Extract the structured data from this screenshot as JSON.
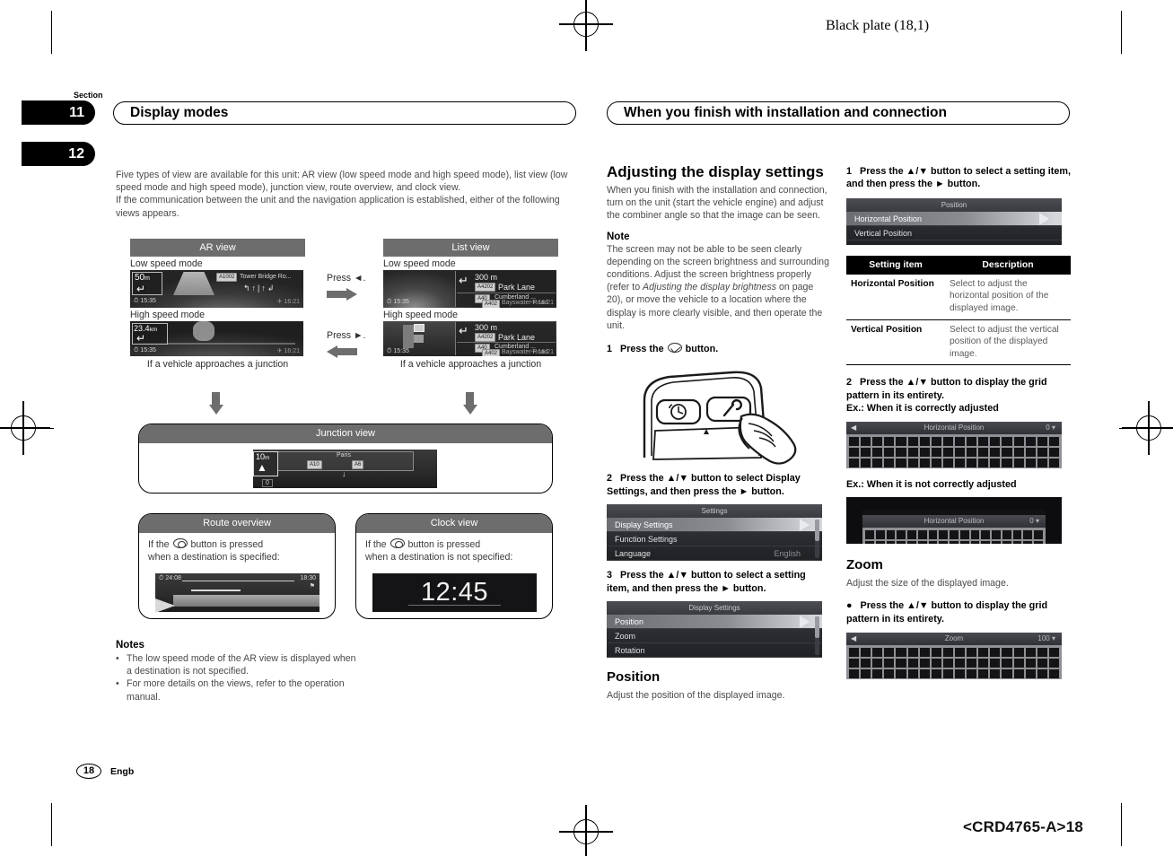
{
  "page": {
    "black_plate": "Black plate (18,1)",
    "crd_code": "<CRD4765-A>18",
    "page_number": "18",
    "language_code": "Engb",
    "section_label": "Section",
    "section_numbers": [
      "11",
      "12"
    ]
  },
  "left": {
    "chapter_title": "Display modes",
    "intro": "Five types of view are available for this unit: AR view (low speed mode and high speed mode), list view (low speed mode and high speed mode), junction view, route overview, and clock view.",
    "intro2": "If the communication between the unit and the navigation application is established, either of the following views appears.",
    "ar_view": {
      "title": "AR view",
      "low_label": "Low speed mode",
      "high_label": "High speed mode",
      "caption": "If a vehicle approaches a junction",
      "low_screen": {
        "distance": "50",
        "distance_unit": "m",
        "road_badge": "A1002",
        "road_name": "Tower Bridge Ro...",
        "time_left": "15:35",
        "time_right": "16:21"
      },
      "high_screen": {
        "distance": "23.4",
        "distance_unit": "km",
        "time_left": "15:35",
        "time_right": "16:21"
      }
    },
    "list_view": {
      "title": "List view",
      "low_label": "Low speed mode",
      "high_label": "High speed mode",
      "caption": "If a vehicle approaches a junction",
      "screen": {
        "distance": "300 m",
        "badge1": "A4202",
        "road1": "Park Lane",
        "badge2": "A40",
        "road2": "Cumberland ...",
        "badge3": "A402",
        "road3": "Bayswater Road",
        "time_left": "15:35",
        "time_right": "16:21"
      }
    },
    "press_left": "Press ◄.",
    "press_right": "Press ►.",
    "junction_view": {
      "title": "Junction view",
      "screen": {
        "distance": "10",
        "distance_unit": "m",
        "city": "Paris",
        "badge1": "A10",
        "badge2": "A6",
        "lane_value": "0"
      }
    },
    "route_overview": {
      "title": "Route overview",
      "text_line1": "If the",
      "text_line1b": "button is pressed",
      "text_line2": "when a destination is specified:",
      "screen": {
        "elapsed": "24:08",
        "arrival": "18:30"
      }
    },
    "clock_view": {
      "title": "Clock view",
      "text_line1": "If the",
      "text_line1b": "button is pressed",
      "text_line2": "when a destination is not specified:",
      "screen": {
        "time": "12:45"
      }
    },
    "notes": {
      "heading": "Notes",
      "items": [
        "The low speed mode of the AR view is displayed when a destination is not specified.",
        "For more details on the views, refer to the operation manual."
      ]
    }
  },
  "right": {
    "chapter_title": "When you finish with installation and connection",
    "heading": "Adjusting the display settings",
    "intro": "When you finish with the installation and connection, turn on the unit (start the vehicle engine) and adjust the combiner angle so that the image can be seen.",
    "note": {
      "heading": "Note",
      "text_a": "The screen may not be able to be seen clearly depending on the screen brightness and surrounding conditions. Adjust the screen brightness properly (refer to ",
      "text_italic": "Adjusting the display brightness",
      "text_b": " on page 20), or move the vehicle to a location where the display is more clearly visible, and then operate the unit."
    },
    "step1": {
      "num": "1",
      "text_a": "Press the",
      "text_b": "button."
    },
    "step2": {
      "num": "2",
      "text": "Press the ▲/▼ button to select Display Settings, and then press the ► button."
    },
    "settings_screen": {
      "title": "Settings",
      "rows": [
        {
          "label": "Display Settings",
          "value": "",
          "selected": true
        },
        {
          "label": "Function Settings",
          "value": "",
          "selected": false
        },
        {
          "label": "Language",
          "value": "English",
          "selected": false
        }
      ]
    },
    "step3": {
      "num": "3",
      "text": "Press the ▲/▼ button to select a setting item, and then press the ► button."
    },
    "display_settings_screen": {
      "title": "Display Settings",
      "rows": [
        {
          "label": "Position",
          "value": "",
          "selected": true
        },
        {
          "label": "Zoom",
          "value": "",
          "selected": false
        },
        {
          "label": "Rotation",
          "value": "",
          "selected": false
        }
      ]
    },
    "position": {
      "heading": "Position",
      "description": "Adjust the position of the displayed image."
    },
    "pos_step1": {
      "num": "1",
      "text": "Press the ▲/▼ button to select a setting item, and then press the ► button."
    },
    "position_screen": {
      "title": "Position",
      "rows": [
        {
          "label": "Horizontal Position",
          "value": "",
          "selected": true
        },
        {
          "label": "Vertical Position",
          "value": "",
          "selected": false
        }
      ]
    },
    "table": {
      "headers": [
        "Setting item",
        "Description"
      ],
      "rows": [
        {
          "item": "Horizontal Position",
          "desc": "Select to adjust the horizontal position of the displayed image."
        },
        {
          "item": "Vertical Position",
          "desc": "Select to adjust the vertical position of the displayed image."
        }
      ]
    },
    "pos_step2": {
      "num": "2",
      "text": "Press the ▲/▼ button to display the grid pattern in its entirety.",
      "ex_ok": "Ex.: When it is correctly adjusted",
      "ex_bad": "Ex.: When it is not correctly adjusted"
    },
    "grid_ok": {
      "title": "Horizontal Position",
      "value": "0"
    },
    "grid_bad": {
      "title": "Horizontal Position",
      "value": "0"
    },
    "zoom": {
      "heading": "Zoom",
      "description": "Adjust the size of the displayed image.",
      "bullet": "●",
      "bullet_text": "Press the ▲/▼ button to display the grid pattern in its entirety."
    },
    "zoom_screen": {
      "title": "Zoom",
      "value": "100"
    }
  },
  "colors": {
    "title_bar_gray": "#6d6d6d",
    "screen_dark": "#1d1d1d",
    "table_header": "#000000",
    "body_text": "#4a4a4a"
  }
}
